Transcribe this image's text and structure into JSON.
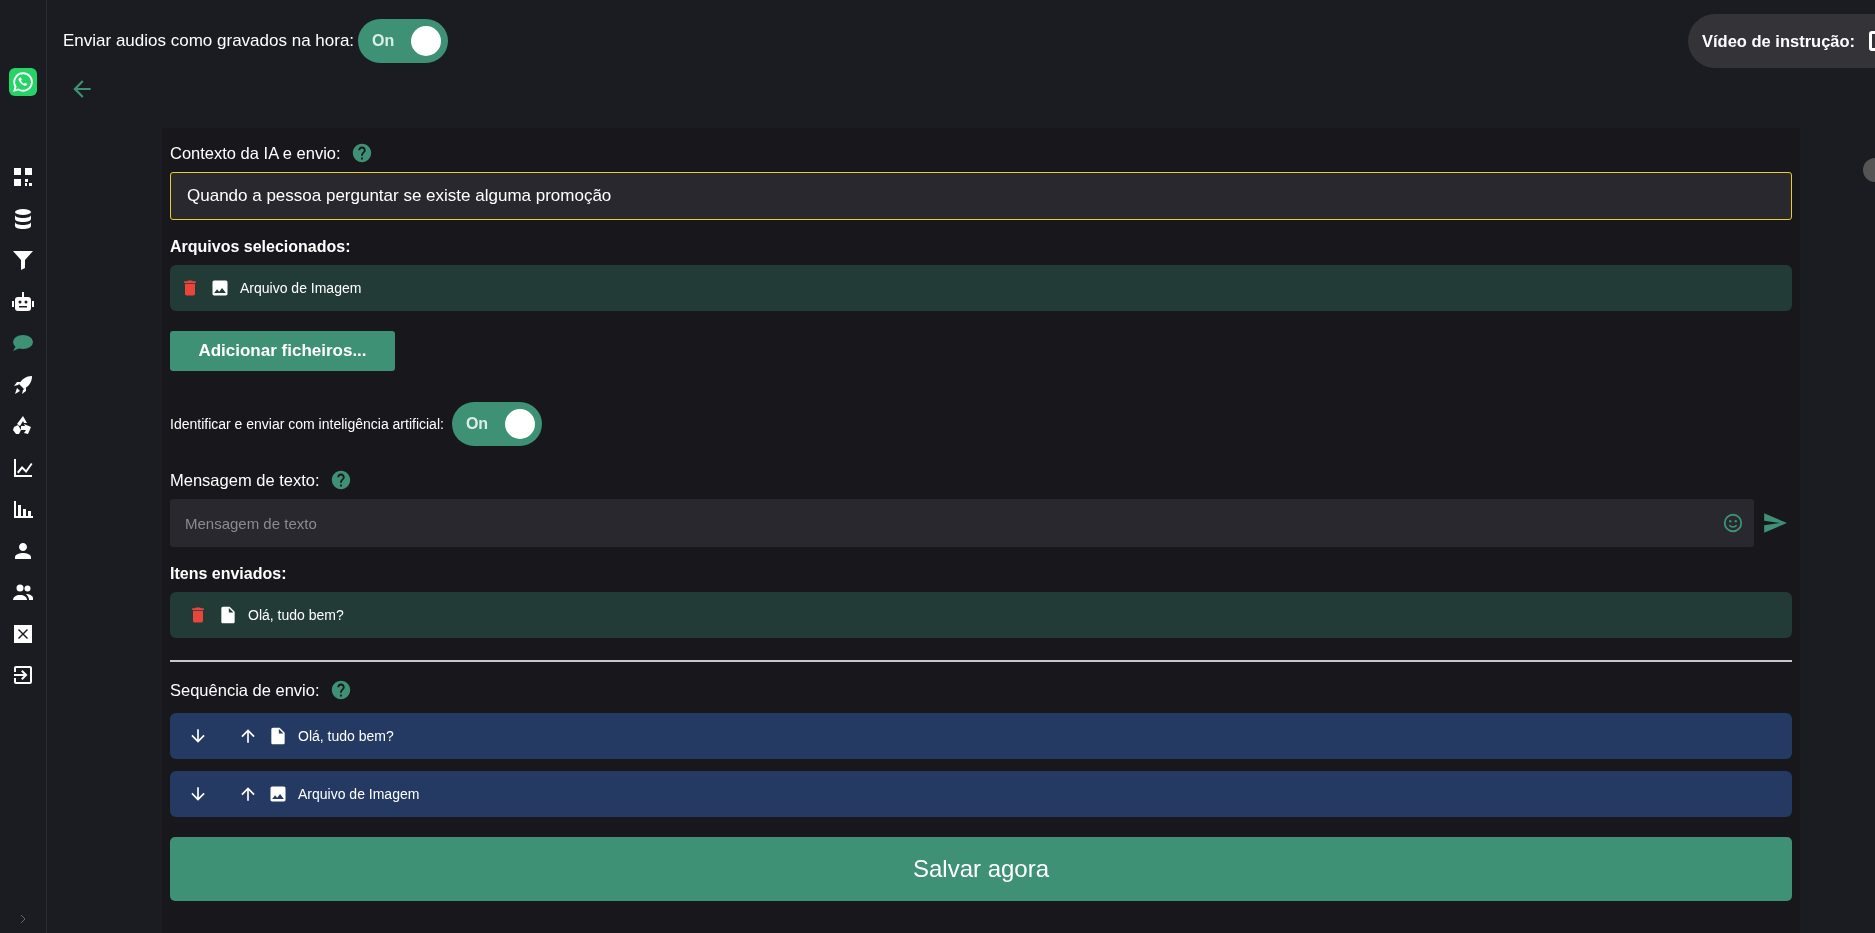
{
  "sidebar": {
    "items": [
      {
        "selected": false
      },
      {
        "selected": false
      },
      {
        "selected": false
      },
      {
        "selected": false
      },
      {
        "selected": true
      },
      {
        "selected": false
      },
      {
        "selected": false
      },
      {
        "selected": false
      },
      {
        "selected": false
      },
      {
        "selected": false
      },
      {
        "selected": false
      },
      {
        "selected": false
      },
      {
        "selected": false
      }
    ]
  },
  "top_toggle": {
    "label": "Enviar audios como gravados na hora:",
    "text": "On",
    "on": true
  },
  "video_pill": {
    "label": "Vídeo de instrução:"
  },
  "context": {
    "label": "Contexto da IA e envio:",
    "value": "Quando a pessoa perguntar se existe alguma promoção"
  },
  "selected_files": {
    "label": "Arquivos selecionados:",
    "items": [
      {
        "kind": "image",
        "name": "Arquivo de Imagem"
      }
    ]
  },
  "add_button": "Adicionar ficheiros...",
  "ai_toggle": {
    "label": "Identificar e enviar com inteligência artificial:",
    "text": "On",
    "on": true
  },
  "message": {
    "label": "Mensagem de texto:",
    "placeholder": "Mensagem de texto"
  },
  "sent_items": {
    "label": "Itens enviados:",
    "items": [
      {
        "kind": "text",
        "name": "Olá, tudo bem?"
      }
    ]
  },
  "sequence": {
    "label": "Sequência de envio:",
    "items": [
      {
        "kind": "text",
        "name": "Olá, tudo bem?"
      },
      {
        "kind": "image",
        "name": "Arquivo de Imagem"
      }
    ]
  },
  "save_button": "Salvar agora"
}
